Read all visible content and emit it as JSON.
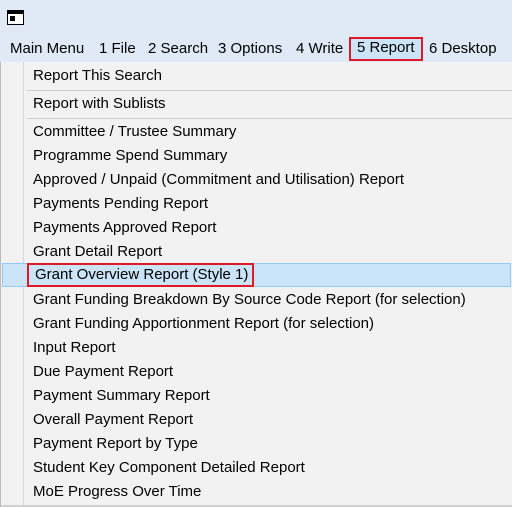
{
  "window": {
    "app_icon": "window-app-icon"
  },
  "menubar": {
    "items": [
      {
        "label": "Main Menu"
      },
      {
        "label": "1 File"
      },
      {
        "label": "2 Search"
      },
      {
        "label": "3 Options"
      },
      {
        "label": "4 Write"
      },
      {
        "label": "5 Report",
        "active": true
      },
      {
        "label": "6 Desktop"
      }
    ]
  },
  "report_menu": {
    "items": [
      {
        "label": "Report This Search"
      },
      {
        "label": "Report with Sublists"
      },
      {
        "label": "Committee / Trustee Summary"
      },
      {
        "label": "Programme Spend Summary"
      },
      {
        "label": "Approved / Unpaid (Commitment and Utilisation) Report"
      },
      {
        "label": "Payments Pending Report"
      },
      {
        "label": "Payments Approved Report"
      },
      {
        "label": "Grant Detail Report"
      },
      {
        "label": "Grant Overview Report (Style 1)",
        "highlighted": true
      },
      {
        "label": "Grant Funding Breakdown By Source Code Report (for selection)"
      },
      {
        "label": "Grant Funding Apportionment Report (for selection)"
      },
      {
        "label": "Input Report"
      },
      {
        "label": "Due Payment Report"
      },
      {
        "label": "Payment Summary Report"
      },
      {
        "label": "Overall Payment Report"
      },
      {
        "label": "Payment Report by Type"
      },
      {
        "label": "Student Key Component Detailed Report"
      },
      {
        "label": "MoE Progress Over Time"
      }
    ]
  }
}
